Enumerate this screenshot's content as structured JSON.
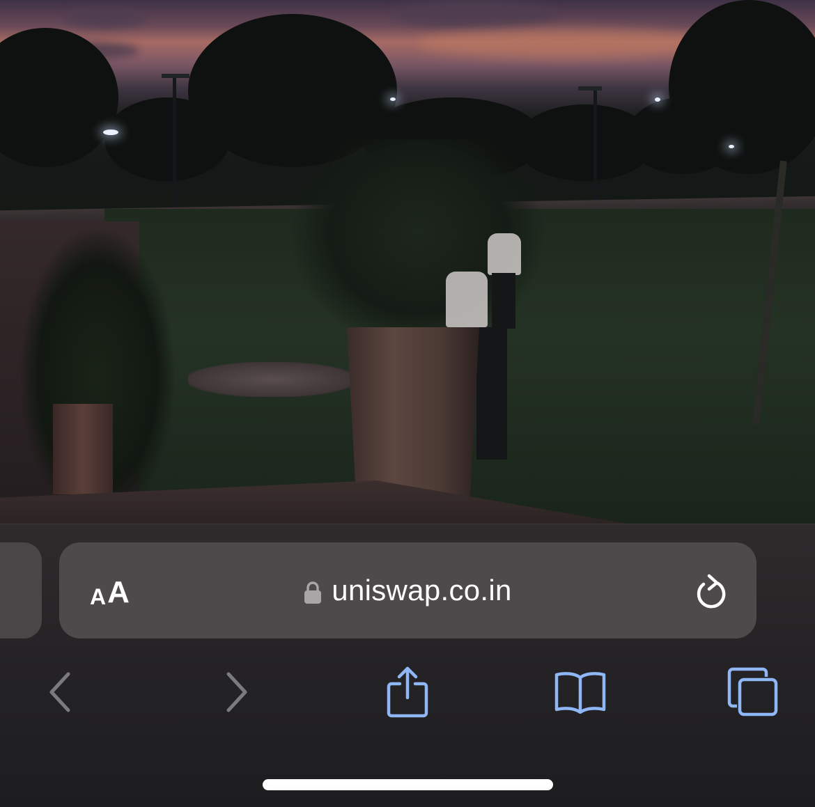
{
  "address_bar": {
    "text_size_small": "A",
    "text_size_large": "A",
    "url": "uniswap.co.in"
  },
  "icons": {
    "lock": "lock-icon",
    "reload": "reload-icon",
    "back": "chevron-left-icon",
    "forward": "chevron-right-icon",
    "share": "share-icon",
    "bookmarks": "book-icon",
    "tabs": "tabs-icon"
  },
  "colors": {
    "accent": "#8fb6f5",
    "disabled": "#7b7a7d",
    "bar_background": "#4e494b",
    "text": "#ffffff"
  }
}
